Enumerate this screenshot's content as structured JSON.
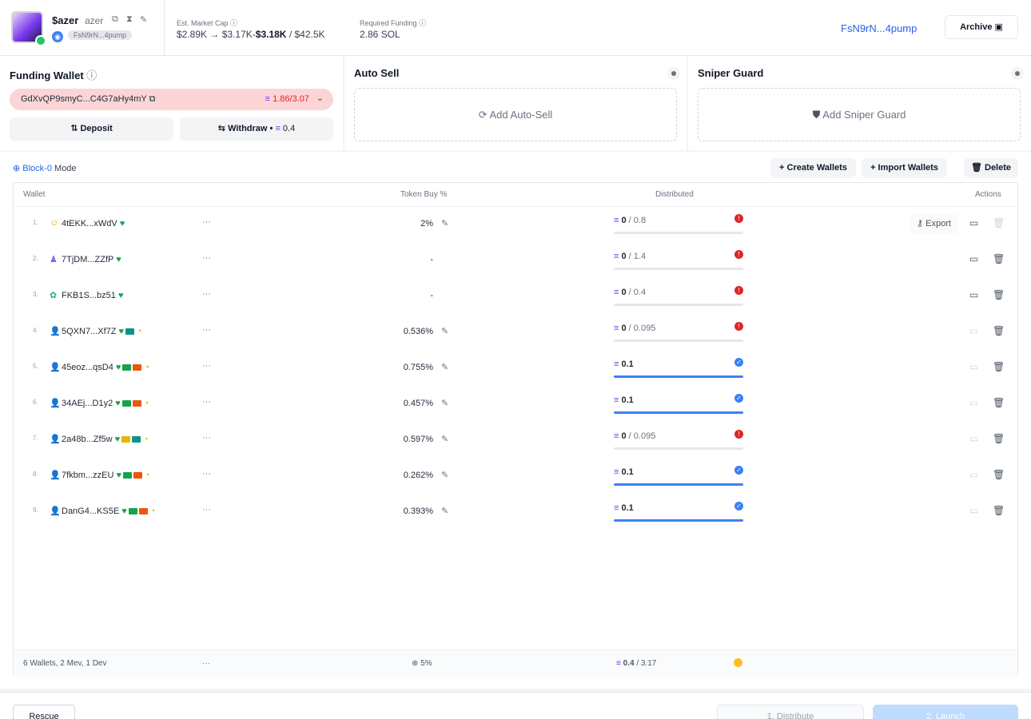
{
  "token": {
    "ticker": "$azer",
    "name": "azer",
    "address_short": "FsN9rN...4pump",
    "mint_link": "FsN9rN...4pump"
  },
  "stats": {
    "mcap_label": "Est. Market Cap",
    "mcap_from": "$2.89K",
    "mcap_to": "$3.17K",
    "mcap_current": "$3.18K",
    "mcap_target": "/ $42.5K",
    "funding_label": "Required Funding",
    "funding_value": "2.86 SOL"
  },
  "archive_label": "Archive",
  "funding_wallet": {
    "title": "Funding Wallet",
    "address": "GdXvQP9smyC...C4G7aHy4mY",
    "balance": "1.86/3.07",
    "deposit_label": "Deposit",
    "withdraw_label": "Withdraw •",
    "withdraw_amount": "0.4"
  },
  "auto_sell": {
    "title": "Auto Sell",
    "add_label": "Add Auto-Sell"
  },
  "sniper_guard": {
    "title": "Sniper Guard",
    "add_label": "Add Sniper Guard"
  },
  "mode": {
    "name": "Block-0",
    "suffix": " Mode"
  },
  "toolbar": {
    "create_label": "+ Create Wallets",
    "import_label": "+ Import Wallets",
    "delete_label": "Delete"
  },
  "table": {
    "headers": {
      "wallet": "Wallet",
      "buy": "Token Buy %",
      "distributed": "Distributed",
      "actions": "Actions"
    },
    "rows": [
      {
        "idx": "1.",
        "addr": "4tEKK...xWdV",
        "pct": "2%",
        "dist": "0",
        "max": "/ 0.8",
        "progress": 0,
        "ok": false
      },
      {
        "idx": "2.",
        "addr": "7TjDM...ZZfP",
        "pct": "-",
        "dist": "0",
        "max": "/ 1.4",
        "progress": 0,
        "ok": false
      },
      {
        "idx": "3.",
        "addr": "FKB1S...bz51",
        "pct": "-",
        "dist": "0",
        "max": "/ 0.4",
        "progress": 0,
        "ok": false
      },
      {
        "idx": "4.",
        "addr": "5QXN7...Xf7Z",
        "pct": "0.536%",
        "dist": "0",
        "max": "/ 0.095",
        "progress": 0,
        "ok": false
      },
      {
        "idx": "5.",
        "addr": "45eoz...qsD4",
        "pct": "0.755%",
        "dist": "0.1",
        "max": "",
        "progress": 1,
        "ok": true
      },
      {
        "idx": "6.",
        "addr": "34AEj...D1y2",
        "pct": "0.457%",
        "dist": "0.1",
        "max": "",
        "progress": 1,
        "ok": true
      },
      {
        "idx": "7.",
        "addr": "2a48b...Zf5w",
        "pct": "0.597%",
        "dist": "0",
        "max": "/ 0.095",
        "progress": 0,
        "ok": false
      },
      {
        "idx": "8.",
        "addr": "7fkbm...zzEU",
        "pct": "0.262%",
        "dist": "0.1",
        "max": "",
        "progress": 1,
        "ok": true
      },
      {
        "idx": "9.",
        "addr": "DanG4...KS5E",
        "pct": "0.393%",
        "dist": "0.1",
        "max": "",
        "progress": 1,
        "ok": true
      }
    ],
    "export_label": "Export",
    "footer": {
      "summary": "6 Wallets, 2 Mev, 1 Dev",
      "buy_total": "5%",
      "dist_total": "0.4",
      "dist_max": "/ 3.17"
    }
  },
  "bottom": {
    "rescue_label": "Rescue",
    "distribute_label": "1. Distribute",
    "launch_label": "2. Launch"
  },
  "colors": {
    "accent": "#2563eb",
    "error": "#dc2626",
    "success_bar": "#3b82f6",
    "warning": "#fbbf24"
  }
}
